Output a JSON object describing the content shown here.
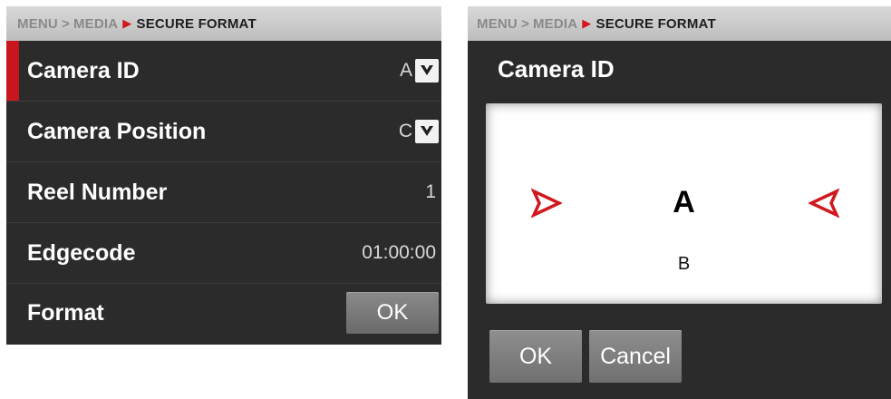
{
  "left": {
    "breadcrumb": {
      "menu": "MENU",
      "media": "MEDIA",
      "current": "SECURE FORMAT",
      "sep": ">"
    },
    "rows": [
      {
        "label": "Camera ID",
        "value": "A"
      },
      {
        "label": "Camera Position",
        "value": "C"
      },
      {
        "label": "Reel Number",
        "value": "1"
      },
      {
        "label": "Edgecode",
        "value": "01:00:00"
      },
      {
        "label": "Format",
        "button": "OK"
      }
    ]
  },
  "right": {
    "breadcrumb": {
      "menu": "MENU",
      "media": "MEDIA",
      "current": "SECURE FORMAT",
      "sep": ">"
    },
    "title": "Camera ID",
    "picker": {
      "current": "A",
      "next": "B"
    },
    "buttons": {
      "ok": "OK",
      "cancel": "Cancel"
    }
  },
  "colors": {
    "accent": "#d0191f",
    "panel": "#2b2b2b",
    "breadcrumb_bar": "#cfcfcf"
  },
  "icons": {
    "breadcrumb_arrow": "red-chevron-right-icon",
    "dropdown": "chevron-down-icon",
    "picker_prev": "red-chevron-right-icon",
    "picker_next": "red-chevron-left-icon"
  }
}
